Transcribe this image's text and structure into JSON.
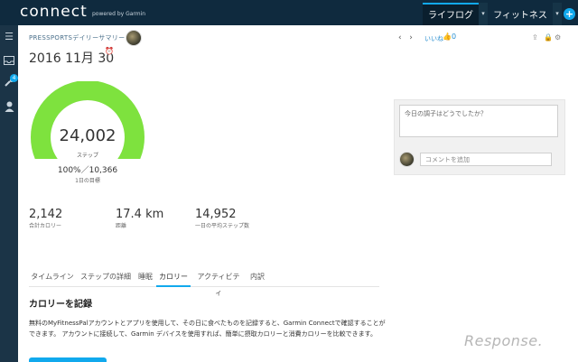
{
  "topbar": {
    "logo": "connect",
    "logo_sub": "powered by Garmin",
    "tabs": [
      {
        "label": "ライフログ",
        "active": true
      },
      {
        "label": "フィットネス",
        "active": false
      }
    ],
    "caret": "▾",
    "plus": "+"
  },
  "sidebar": {
    "icons": [
      "menu-icon",
      "inbox-icon",
      "devices-icon",
      "profile-icon"
    ],
    "badge": "4"
  },
  "header": {
    "page_label": "PRESSPORTSデイリーサマリー",
    "date": "2016 11月 30",
    "prev": "‹",
    "next": "›",
    "like_label": "いいね",
    "like_count": "0"
  },
  "summary": {
    "steps": "24,002",
    "steps_unit": "ステップ",
    "progress_text": "100%／10,366",
    "goal_label": "1日の目標",
    "progress_fraction": 1.0
  },
  "stats": [
    {
      "value": "2,142",
      "label": "合計カロリー"
    },
    {
      "value": "17.4 km",
      "label": "距離"
    },
    {
      "value": "14,952",
      "label": "一日の平均ステップ数"
    }
  ],
  "tabs": [
    {
      "label": "タイムライン",
      "active": false
    },
    {
      "label": "ステップの詳細",
      "active": false
    },
    {
      "label": "睡眠",
      "active": false
    },
    {
      "label": "カロリー",
      "active": true
    },
    {
      "label": "アクティビティ",
      "active": false
    },
    {
      "label": "内訳",
      "active": false
    }
  ],
  "calories": {
    "title": "カロリーを記録",
    "description": "無料のMyFitnessPalアカウントとアプリを使用して、その日に食べたものを記録すると、Garmin Connectで確認することができます。 アカウントに接続して、Garmin デバイスを使用すれば、簡単に摂取カロリーと消費カロリーを比較できます。"
  },
  "comments": {
    "status_placeholder": "今日の調子はどうでしたか？",
    "comment_placeholder": "コメントを追加"
  },
  "watermark": "Response.",
  "colors": {
    "gauge": "#7ee23e",
    "accent": "#11a9ed",
    "topbar": "#0f2a3e",
    "sidebar": "#1b3447"
  }
}
